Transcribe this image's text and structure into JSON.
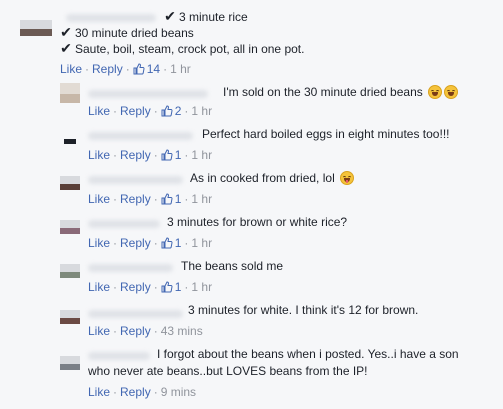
{
  "colors": {
    "link": "#4267b2",
    "meta": "#90949c",
    "text": "#1d2129",
    "background": "#f6f7f9"
  },
  "top_comment": {
    "lines": [
      "3 minute rice",
      "30 minute dried beans",
      "Saute, boil, steam, crock pot, all in one pot."
    ],
    "check_icon": "check-mark-icon",
    "meta": {
      "like": "Like",
      "reply": "Reply",
      "likes": "14",
      "time": "1 hr"
    }
  },
  "replies": [
    {
      "text": "I'm sold on the 30 minute dried beans",
      "emoji": "laughing-tears-icon",
      "meta": {
        "like": "Like",
        "reply": "Reply",
        "likes": "2",
        "time": "1 hr"
      }
    },
    {
      "text": "Perfect hard boiled eggs in eight minutes too!!!",
      "meta": {
        "like": "Like",
        "reply": "Reply",
        "likes": "1",
        "time": "1 hr"
      }
    },
    {
      "text": "As in cooked from dried, lol",
      "emoji": "tongue-out-icon",
      "meta": {
        "like": "Like",
        "reply": "Reply",
        "likes": "1",
        "time": "1 hr"
      }
    },
    {
      "text": "3 minutes for brown or white rice?",
      "meta": {
        "like": "Like",
        "reply": "Reply",
        "likes": "1",
        "time": "1 hr"
      }
    },
    {
      "text": "The beans sold me",
      "meta": {
        "like": "Like",
        "reply": "Reply",
        "likes": "1",
        "time": "1 hr"
      }
    },
    {
      "text": "3 minutes for white. I think it's 12 for brown.",
      "meta": {
        "like": "Like",
        "reply": "Reply",
        "time": "43 mins"
      }
    },
    {
      "text_lines": [
        "I forgot about the beans when i posted. Yes..i have a son",
        "who never ate beans..but LOVES beans from the IP!"
      ],
      "meta": {
        "like": "Like",
        "reply": "Reply",
        "time": "9 mins"
      }
    }
  ]
}
